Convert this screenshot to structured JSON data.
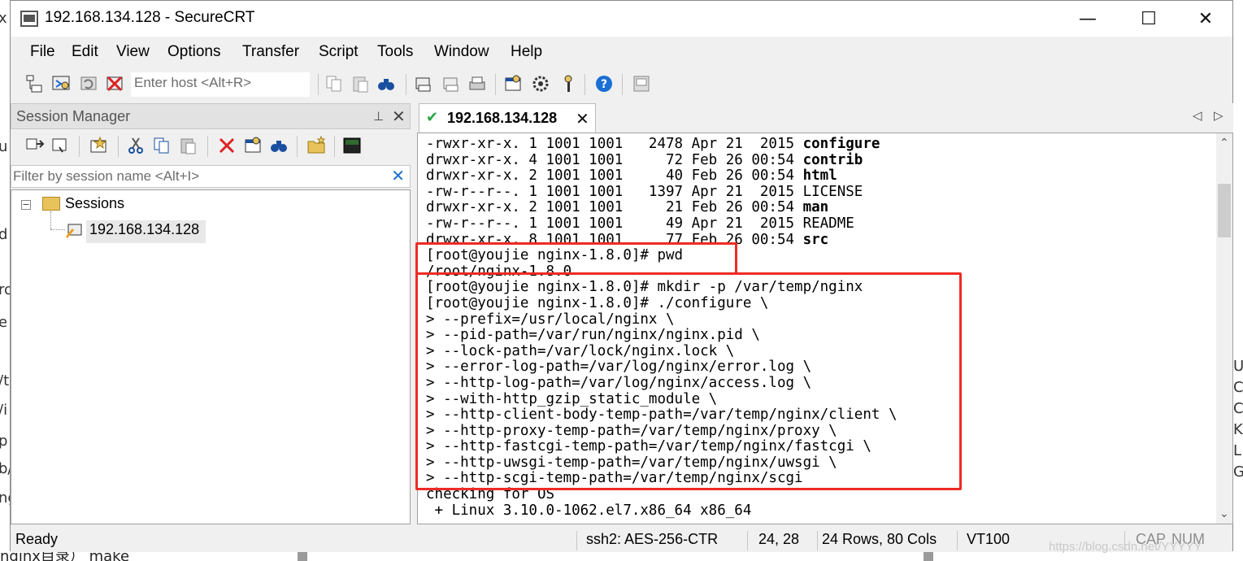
{
  "window": {
    "title": "192.168.134.128 - SecureCRT",
    "minimize": "—",
    "maximize": "☐",
    "close": "✕"
  },
  "menu": [
    "File",
    "Edit",
    "View",
    "Options",
    "Transfer",
    "Script",
    "Tools",
    "Window",
    "Help"
  ],
  "toolbar": {
    "host_placeholder": "Enter host <Alt+R>"
  },
  "session_manager": {
    "title": "Session Manager",
    "pin": "⊥",
    "close": "✕",
    "filter_placeholder": "Filter by session name <Alt+I>",
    "filter_clear": "✕",
    "tree": {
      "expander": "−",
      "root": "Sessions",
      "child": "192.168.134.128"
    }
  },
  "tab": {
    "label": "192.168.134.128",
    "check": "✔",
    "close": "✕",
    "nav_left": "◁",
    "nav_right": "▷"
  },
  "terminal": {
    "lines": [
      {
        "plain": "-rwxr-xr-x. 1 1001 1001   2478 Apr 21  2015 ",
        "bold": "configure"
      },
      {
        "plain": "drwxr-xr-x. 4 1001 1001     72 Feb 26 00:54 ",
        "bold": "contrib"
      },
      {
        "plain": "drwxr-xr-x. 2 1001 1001     40 Feb 26 00:54 ",
        "bold": "html"
      },
      {
        "plain": "-rw-r--r--. 1 1001 1001   1397 Apr 21  2015 LICENSE",
        "bold": ""
      },
      {
        "plain": "drwxr-xr-x. 2 1001 1001     21 Feb 26 00:54 ",
        "bold": "man"
      },
      {
        "plain": "-rw-r--r--. 1 1001 1001     49 Apr 21  2015 README",
        "bold": ""
      },
      {
        "plain": "drwxr-xr-x. 8 1001 1001     77 Feb 26 00:54 ",
        "bold": "src"
      },
      {
        "plain": "[root@youjie nginx-1.8.0]# pwd",
        "bold": ""
      },
      {
        "plain": "/root/nginx-1.8.0",
        "bold": ""
      },
      {
        "plain": "[root@youjie nginx-1.8.0]# mkdir -p /var/temp/nginx",
        "bold": ""
      },
      {
        "plain": "[root@youjie nginx-1.8.0]# ./configure \\",
        "bold": ""
      },
      {
        "plain": "> --prefix=/usr/local/nginx \\",
        "bold": ""
      },
      {
        "plain": "> --pid-path=/var/run/nginx/nginx.pid \\",
        "bold": ""
      },
      {
        "plain": "> --lock-path=/var/lock/nginx.lock \\",
        "bold": ""
      },
      {
        "plain": "> --error-log-path=/var/log/nginx/error.log \\",
        "bold": ""
      },
      {
        "plain": "> --http-log-path=/var/log/nginx/access.log \\",
        "bold": ""
      },
      {
        "plain": "> --with-http_gzip_static_module \\",
        "bold": ""
      },
      {
        "plain": "> --http-client-body-temp-path=/var/temp/nginx/client \\",
        "bold": ""
      },
      {
        "plain": "> --http-proxy-temp-path=/var/temp/nginx/proxy \\",
        "bold": ""
      },
      {
        "plain": "> --http-fastcgi-temp-path=/var/temp/nginx/fastcgi \\",
        "bold": ""
      },
      {
        "plain": "> --http-uwsgi-temp-path=/var/temp/nginx/uwsgi \\",
        "bold": ""
      },
      {
        "plain": "> --http-scgi-temp-path=/var/temp/nginx/scgi",
        "bold": ""
      },
      {
        "plain": "checking for OS",
        "bold": ""
      },
      {
        "plain": " + Linux 3.10.0-1062.el7.x86_64 x86_64",
        "bold": ""
      }
    ],
    "scroll_up": "⌃",
    "scroll_down": "⌄"
  },
  "status": {
    "ready": "Ready",
    "cipher": "ssh2: AES-256-CTR",
    "cursor": "24,  28",
    "size": "24 Rows, 80 Cols",
    "emulation": "VT100",
    "cap": "CAP",
    "num": "NUM"
  },
  "watermark": "https://blog.csdn.net/YYYYY",
  "background": {
    "left_letters": [
      "x",
      "u",
      "d",
      "ro",
      "e",
      "/t",
      "/i",
      "p",
      "b/",
      "ng"
    ],
    "right_letters": [
      "U",
      "C",
      "C",
      "K",
      "L",
      "G"
    ],
    "bottom_text": "nginx目录） make"
  },
  "colors": {
    "highlight": "#ee2b24",
    "check": "#27a745",
    "filter_clear": "#1a6fd4"
  }
}
